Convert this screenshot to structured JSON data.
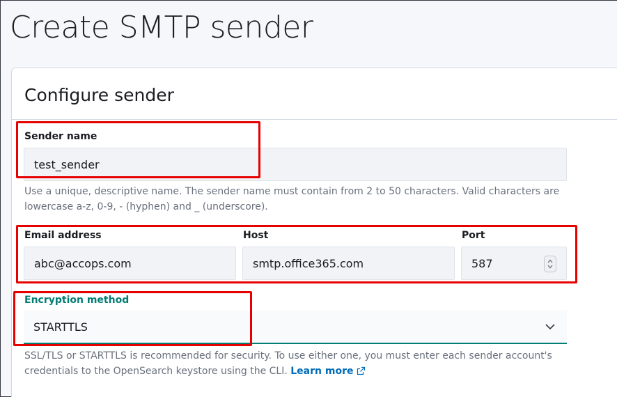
{
  "page": {
    "title": "Create SMTP sender"
  },
  "panel": {
    "title": "Configure sender"
  },
  "sender_name": {
    "label": "Sender name",
    "value": "test_sender",
    "help_line1": "Use a unique, descriptive name. The sender name must contain from 2 to 50 characters. Valid characters are",
    "help_line2": "lowercase a-z, 0-9, - (hyphen) and _ (underscore)."
  },
  "email": {
    "label": "Email address",
    "value": "abc@accops.com"
  },
  "host": {
    "label": "Host",
    "value": "smtp.office365.com"
  },
  "port": {
    "label": "Port",
    "value": "587"
  },
  "encryption": {
    "label": "Encryption method",
    "value": "STARTTLS",
    "help_line1": "SSL/TLS or STARTTLS is recommended for security. To use either one, you must enter each sender account's",
    "help_line2": "credentials to the OpenSearch keystore using the CLI.",
    "learn_more": "Learn more"
  },
  "colors": {
    "highlight": "#e60000",
    "accent": "#017d73",
    "link": "#006bb8"
  },
  "icons": {
    "select_chevron": "chevron-down-icon",
    "port_stepper": "stepper-icon",
    "learn_more": "external-link-icon"
  }
}
